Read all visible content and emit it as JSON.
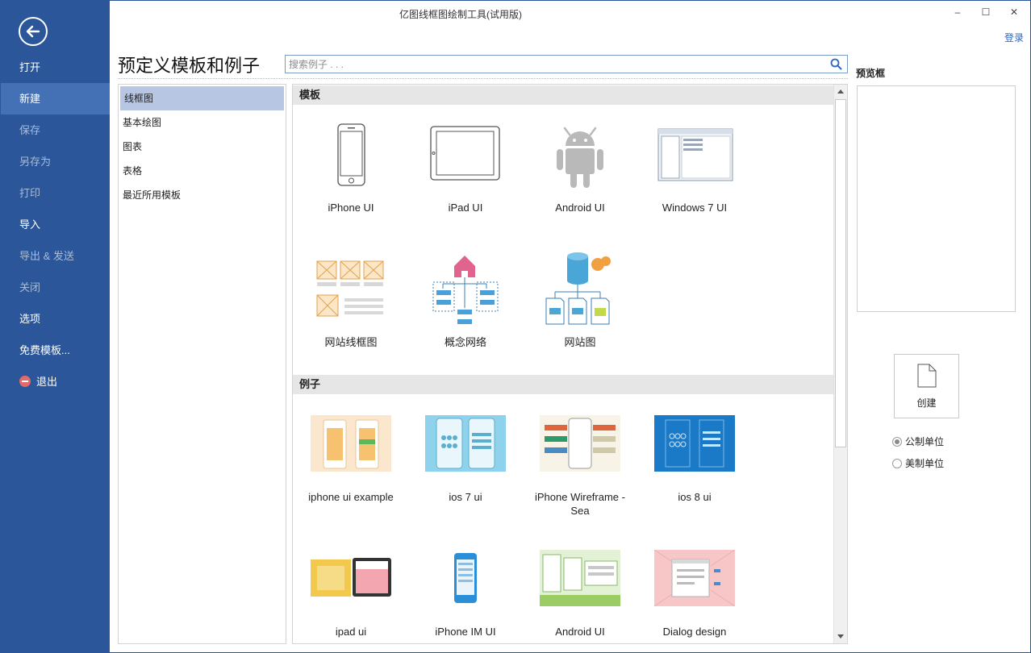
{
  "window": {
    "title": "亿图线框图绘制工具(试用版)",
    "minimize": "–",
    "maximize": "☐",
    "close": "✕",
    "login": "登录"
  },
  "nav": {
    "items": [
      {
        "label": "打开",
        "state": "enabled"
      },
      {
        "label": "新建",
        "state": "active"
      },
      {
        "label": "保存",
        "state": "disabled"
      },
      {
        "label": "另存为",
        "state": "disabled"
      },
      {
        "label": "打印",
        "state": "disabled"
      },
      {
        "label": "导入",
        "state": "enabled"
      },
      {
        "label": "导出 & 发送",
        "state": "disabled"
      },
      {
        "label": "关闭",
        "state": "disabled"
      },
      {
        "label": "选项",
        "state": "enabled"
      },
      {
        "label": "免费模板...",
        "state": "enabled"
      },
      {
        "label": "退出",
        "state": "enabled"
      }
    ]
  },
  "header": {
    "title": "预定义模板和例子",
    "search_placeholder": "搜索例子 . . ."
  },
  "categories": [
    "线框图",
    "基本绘图",
    "图表",
    "表格",
    "最近所用模板"
  ],
  "templates": {
    "heading": "模板",
    "items": [
      "iPhone UI",
      "iPad UI",
      "Android UI",
      "Windows 7 UI",
      "网站线框图",
      "概念网络",
      "网站图"
    ]
  },
  "examples": {
    "heading": "例子",
    "items": [
      "iphone ui example",
      "ios 7 ui",
      "iPhone Wireframe - Sea",
      "ios 8 ui",
      "ipad ui",
      "iPhone IM UI",
      "Android UI",
      "Dialog design"
    ]
  },
  "right": {
    "preview_label": "预览框",
    "create_label": "创建",
    "units": [
      "公制单位",
      "美制单位"
    ],
    "selected_unit": "公制单位"
  },
  "colors": {
    "nav_bg": "#2b579a",
    "nav_active": "#4471b5",
    "category_selected": "#b6c6e3",
    "link": "#2b65c0"
  }
}
